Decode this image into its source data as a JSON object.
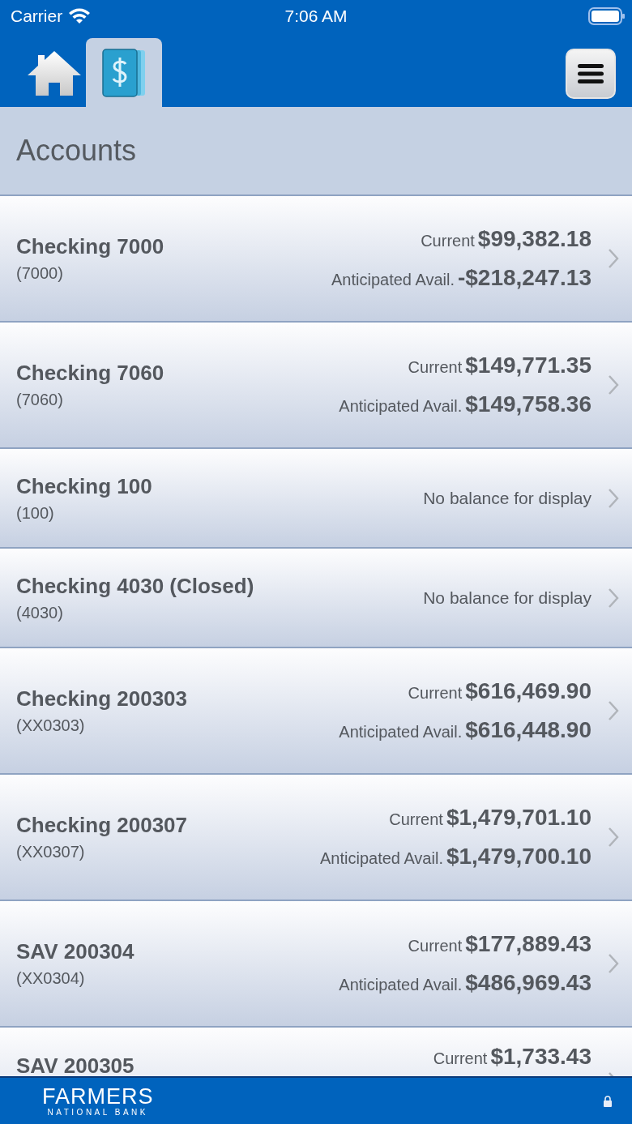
{
  "status_bar": {
    "carrier": "Carrier",
    "time": "7:06 AM"
  },
  "nav": {
    "tabs": [
      {
        "kind": "home",
        "selected": false
      },
      {
        "kind": "accounts",
        "selected": true
      }
    ]
  },
  "header": {
    "title": "Accounts"
  },
  "accounts": [
    {
      "kind": "balance",
      "name": "Checking 7000",
      "number": "(7000)",
      "current_label": "Current",
      "current": "$99,382.18",
      "anticipated_label": "Anticipated Avail.",
      "anticipated": "-$218,247.13"
    },
    {
      "kind": "balance",
      "name": "Checking 7060",
      "number": "(7060)",
      "current_label": "Current",
      "current": "$149,771.35",
      "anticipated_label": "Anticipated Avail.",
      "anticipated": "$149,758.36"
    },
    {
      "kind": "none",
      "name": "Checking 100",
      "number": "(100)",
      "message": "No balance for display"
    },
    {
      "kind": "none",
      "name": "Checking 4030 (Closed)",
      "number": "(4030)",
      "message": "No balance for display"
    },
    {
      "kind": "balance",
      "name": "Checking 200303",
      "number": "(XX0303)",
      "current_label": "Current",
      "current": "$616,469.90",
      "anticipated_label": "Anticipated Avail.",
      "anticipated": "$616,448.90"
    },
    {
      "kind": "balance",
      "name": "Checking 200307",
      "number": "(XX0307)",
      "current_label": "Current",
      "current": "$1,479,701.10",
      "anticipated_label": "Anticipated Avail.",
      "anticipated": "$1,479,700.10"
    },
    {
      "kind": "balance",
      "name": "SAV 200304",
      "number": "(XX0304)",
      "current_label": "Current",
      "current": "$177,889.43",
      "anticipated_label": "Anticipated Avail.",
      "anticipated": "$486,969.43"
    },
    {
      "kind": "balance",
      "name": "SAV 200305",
      "current_label": "Current",
      "current": "$1,733.43"
    }
  ],
  "footer": {
    "logo_name": "FARMERS",
    "logo_sub": "NATIONAL BANK"
  }
}
